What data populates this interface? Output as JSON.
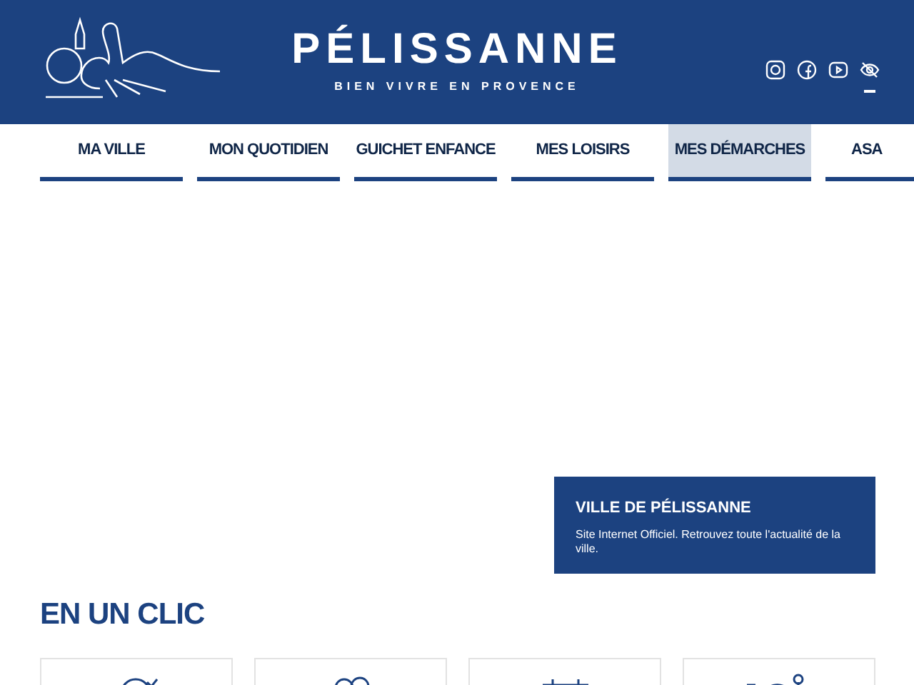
{
  "header": {
    "title": "PÉLISSANNE",
    "tagline": "BIEN VIVRE EN PROVENCE"
  },
  "nav": [
    {
      "label": "MA VILLE",
      "selected": false
    },
    {
      "label": "MON QUOTIDIEN",
      "selected": false
    },
    {
      "label": "GUICHET ENFANCE",
      "selected": false
    },
    {
      "label": "MES LOISIRS",
      "selected": false
    },
    {
      "label": "MES DÉMARCHES",
      "selected": true
    },
    {
      "label": "ASA",
      "selected": false
    }
  ],
  "hero_card": {
    "title": "VILLE DE PÉLISSANNE",
    "text": "Site Internet Officiel. Retrouvez toute l'actualité de la ville."
  },
  "quick_links": {
    "title": "EN UN CLIC",
    "cards": [
      {
        "kind": "planet"
      },
      {
        "kind": "people"
      },
      {
        "kind": "calendar"
      },
      {
        "kind": "cart"
      }
    ]
  }
}
